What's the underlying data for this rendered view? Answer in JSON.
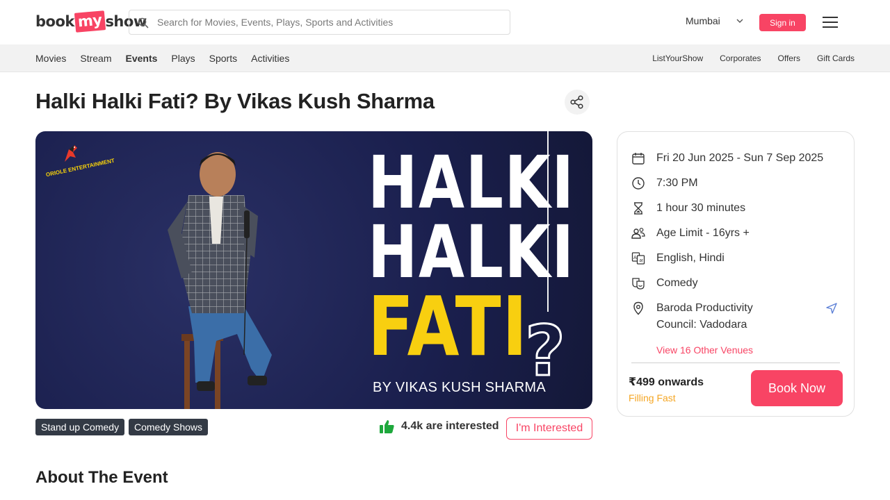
{
  "header": {
    "logo_left": "book",
    "logo_mid": "my",
    "logo_right": "show",
    "search_placeholder": "Search for Movies, Events, Plays, Sports and Activities",
    "city": "Mumbai",
    "signin_label": "Sign in"
  },
  "subnav": {
    "left": [
      "Movies",
      "Stream",
      "Events",
      "Plays",
      "Sports",
      "Activities"
    ],
    "active_index": 2,
    "right": [
      "ListYourShow",
      "Corporates",
      "Offers",
      "Gift Cards"
    ]
  },
  "event": {
    "title": "Halki Halki Fati? By Vikas Kush Sharma",
    "poster": {
      "brand": "ORIOLE ENTERTAINMENT",
      "line1": "HALKI",
      "line2": "HALKI",
      "line3": "FATI",
      "qmark": "?",
      "by": "BY VIKAS KUSH SHARMA"
    },
    "tags": [
      "Stand up Comedy",
      "Comedy Shows"
    ],
    "interested_count": "4.4k are interested",
    "interested_button": "I'm Interested",
    "about_heading": "About The Event"
  },
  "info": {
    "dates": "Fri 20 Jun 2025 - Sun 7 Sep 2025",
    "time": "7:30 PM",
    "duration": "1 hour 30 minutes",
    "age": "Age Limit - 16yrs +",
    "languages": "English, Hindi",
    "genre": "Comedy",
    "venue": "Baroda Productivity Council: Vadodara",
    "other_venues": "View 16 Other Venues",
    "price": "₹499 onwards",
    "availability": "Filling Fast",
    "book_label": "Book Now"
  },
  "colors": {
    "brand": "#f84464",
    "filling": "#f5a623",
    "tag_bg": "#333a45",
    "poster_yellow": "#f8cf10"
  }
}
